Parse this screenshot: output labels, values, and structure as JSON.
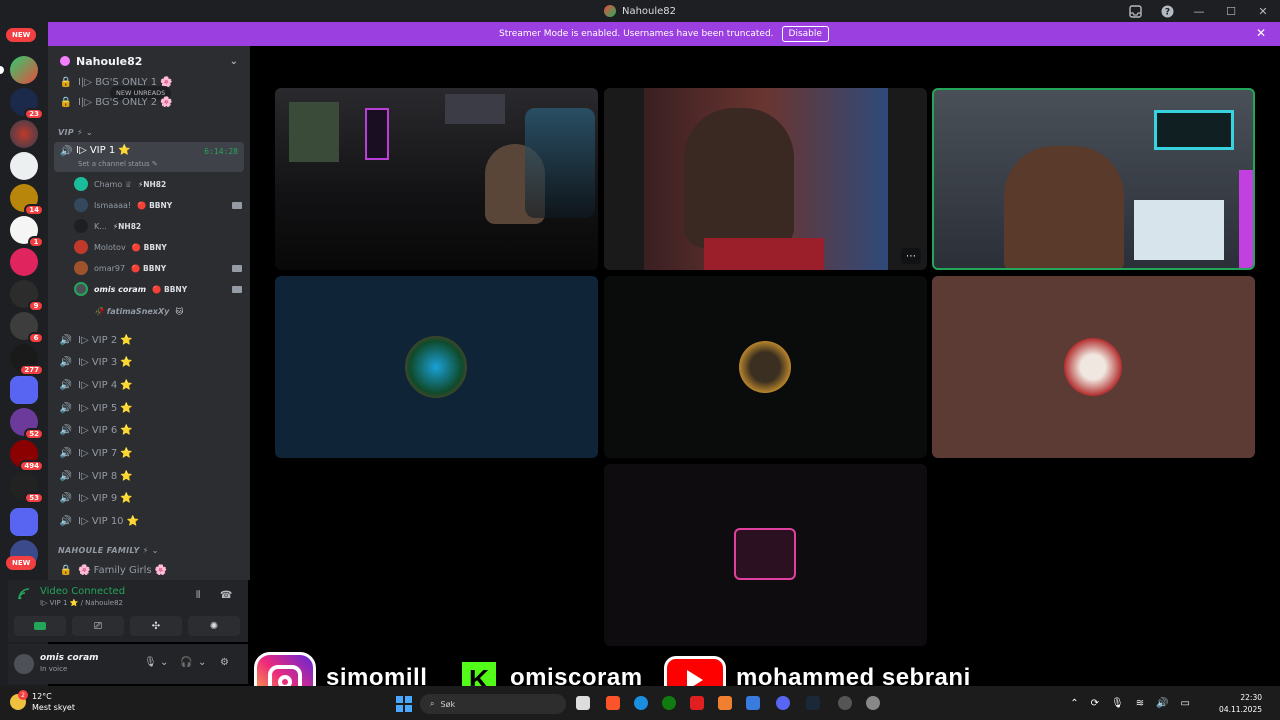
{
  "window": {
    "title": "Nahoule82"
  },
  "banner": {
    "text": "Streamer Mode is enabled. Usernames have been truncated.",
    "button": "Disable"
  },
  "server_rail": {
    "new_top": "NEW",
    "top_badge": "233",
    "new_bottom": "NEW",
    "badges": [
      "23",
      "14",
      "1",
      "9",
      "6",
      "277",
      "52",
      "494",
      "53"
    ]
  },
  "guild": {
    "name": "Nahoule82"
  },
  "channels": {
    "new_unreads": "NEW UNREADS",
    "bgs_only_1": "I|▷ BG'S ONLY 1 🌸",
    "bgs_only_2": "I|▷ BG'S ONLY 2 🌸",
    "cat_vip": "VIP ⚡ ⌄",
    "active": {
      "name": "I▷ VIP 1 ⭐",
      "timer": "6:14:28",
      "status": "Set a channel status ✎"
    },
    "members": [
      {
        "name": "Chamo ♕",
        "tag": "⚡NH82",
        "cam": false
      },
      {
        "name": "Ismaaaa!",
        "tag": "🔴 BBNY",
        "cam": true
      },
      {
        "name": "K...",
        "tag": "⚡NH82",
        "cam": false
      },
      {
        "name": "Molotov",
        "tag": "🔴 BBNY",
        "cam": false
      },
      {
        "name": "omar97",
        "tag": "🔴 BBNY",
        "cam": true
      },
      {
        "name": "omis coram",
        "tag": "🔴 BBNY",
        "cam": true
      },
      {
        "name": "🥀 fatimaSnexXy",
        "tag": "🐱",
        "cam": false
      }
    ],
    "vip_list": [
      "I▷ VIP 2 ⭐",
      "I▷ VIP 3 ⭐",
      "I▷ VIP 4 ⭐",
      "I▷ VIP 5 ⭐",
      "I▷ VIP 6 ⭐",
      "I▷ VIP 7 ⭐",
      "I▷ VIP 8 ⭐",
      "I▷ VIP 9 ⭐",
      "I▷ VIP 10 ⭐"
    ],
    "cat_family": "NAHOULE FAMILY ⚡ ⌄",
    "family_girls": "🌸 Family Girls 🌸"
  },
  "voice": {
    "status": "Video Connected",
    "channel": "I▷ VIP 1 ⭐ / Nahoule82"
  },
  "user": {
    "name": "omis coram",
    "sub": "In voice"
  },
  "overlay": {
    "instagram": "simomill",
    "kick": "omiscoram",
    "youtube": "mohammed sebrani",
    "kick_letter": "K"
  },
  "taskbar": {
    "temp": "12°C",
    "weather": "Mest skyet",
    "weather_badge": "2",
    "search": "Søk",
    "time": "22:30",
    "date": "04.11.2025"
  },
  "colors": {
    "brand": "#5865f2",
    "connected": "#23a55a",
    "banner": "#9b3fe0",
    "badge": "#f23f42"
  }
}
